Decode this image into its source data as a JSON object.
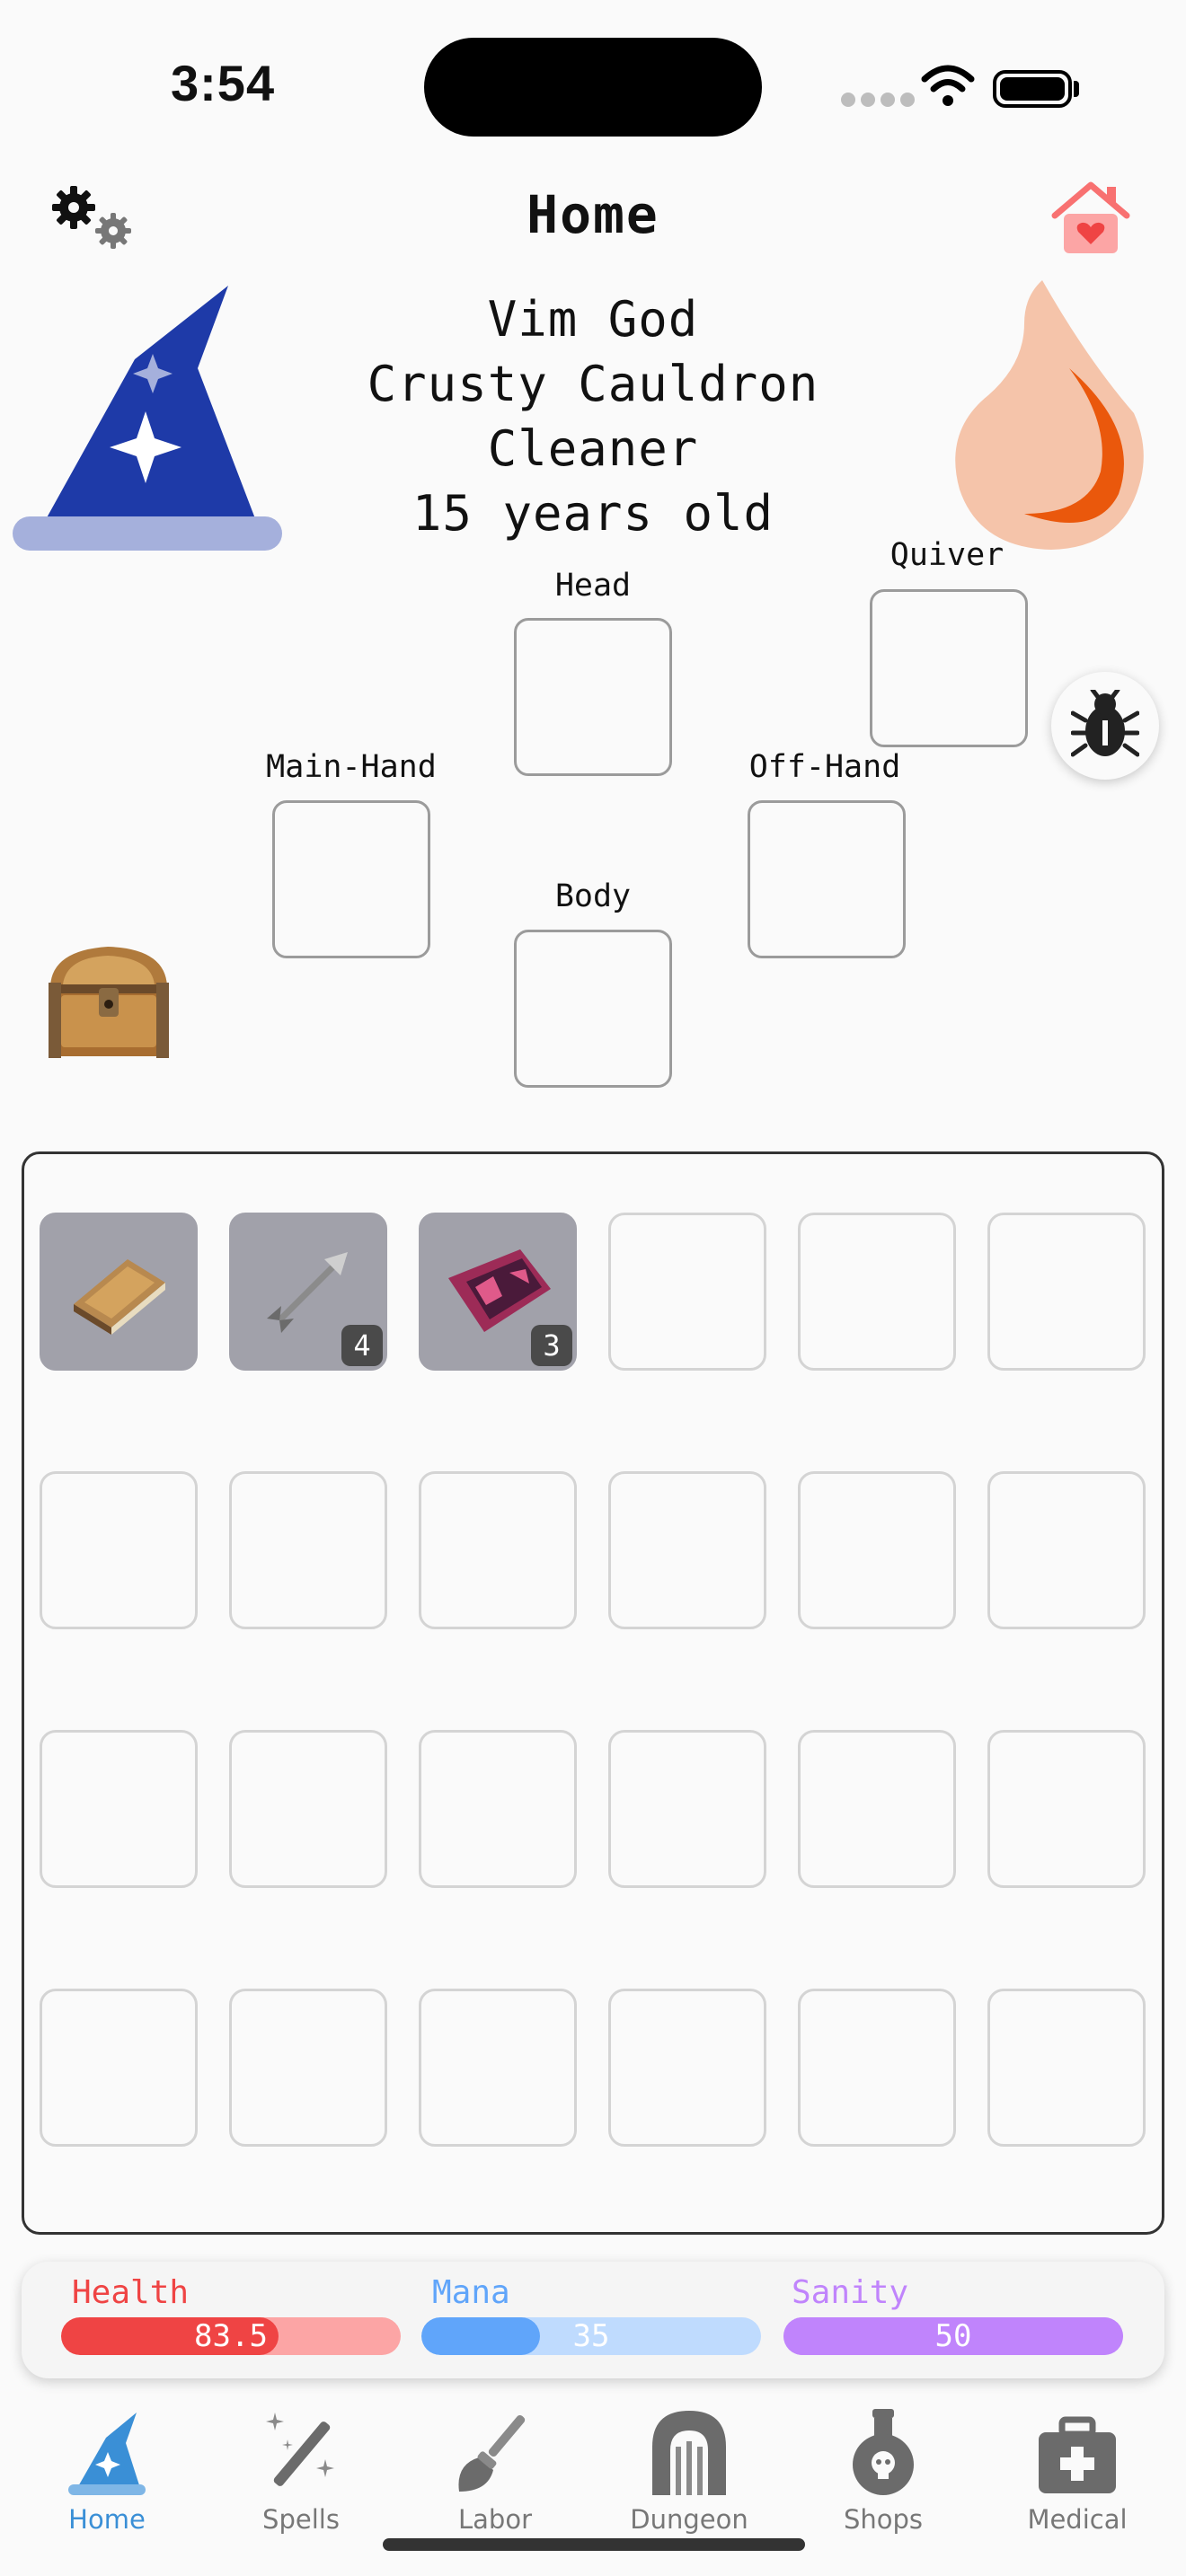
{
  "status_bar": {
    "time": "3:54"
  },
  "header": {
    "title": "Home",
    "settings_icon": "gear-icon",
    "home_icon": "house-heart-icon"
  },
  "profile": {
    "lines": [
      "Vim God",
      "Crusty Cauldron",
      "Cleaner",
      "15 years old"
    ],
    "avatar_icon": "wizard-hat-icon",
    "element_icon": "fire-icon",
    "debug_icon": "bug-icon",
    "chest_icon": "treasure-chest-icon"
  },
  "equipment": {
    "head": "Head",
    "quiver": "Quiver",
    "main_hand": "Main-Hand",
    "off_hand": "Off-Hand",
    "body": "Body"
  },
  "inventory": {
    "items": [
      {
        "icon": "book-icon",
        "quantity": ""
      },
      {
        "icon": "arrow-icon",
        "quantity": "4"
      },
      {
        "icon": "crystal-icon",
        "quantity": "3"
      }
    ],
    "total_slots": 24
  },
  "stats": {
    "health": {
      "label": "Health",
      "value": "83.5",
      "fraction": 0.64,
      "color": "#ef4444",
      "track": "#fca5a5"
    },
    "mana": {
      "label": "Mana",
      "value": "35",
      "fraction": 0.35,
      "color": "#60a5fa",
      "track": "#bfdbfe"
    },
    "sanity": {
      "label": "Sanity",
      "value": "50",
      "fraction": 1.0,
      "color": "#c084fc",
      "track": "#c084fc"
    }
  },
  "tabs": [
    {
      "label": "Home",
      "icon": "wizard-hat-icon",
      "active": true
    },
    {
      "label": "Spells",
      "icon": "magic-wand-icon",
      "active": false
    },
    {
      "label": "Labor",
      "icon": "broom-icon",
      "active": false
    },
    {
      "label": "Dungeon",
      "icon": "dungeon-gate-icon",
      "active": false
    },
    {
      "label": "Shops",
      "icon": "potion-icon",
      "active": false
    },
    {
      "label": "Medical",
      "icon": "medical-kit-icon",
      "active": false
    }
  ]
}
